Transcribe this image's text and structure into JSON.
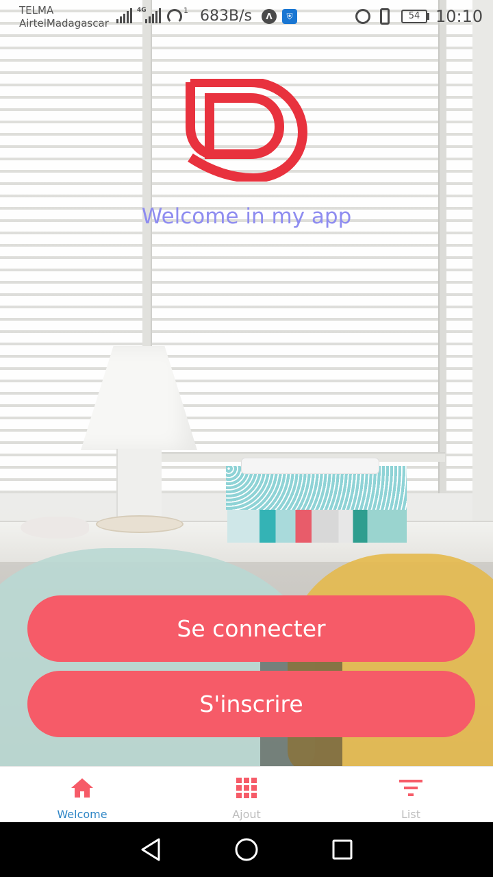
{
  "status_bar": {
    "carrier_line1": "TELMA",
    "carrier_line2": "AirtelMadagascar",
    "network_type": "4G",
    "hotspot_count": "1",
    "speed": "683B/s",
    "battery_level": "54",
    "time": "10:10",
    "icons": [
      "signal-icon",
      "network-4g-icon",
      "hotspot-icon",
      "vpn-icon",
      "shield-icon",
      "alarm-icon",
      "vibrate-icon",
      "battery-icon"
    ]
  },
  "welcome": {
    "title": "Welcome in my app"
  },
  "actions": {
    "login_label": "Se connecter",
    "signup_label": "S'inscrire"
  },
  "tabs": [
    {
      "label": "Welcome",
      "icon": "home-icon",
      "active": true
    },
    {
      "label": "Ajout",
      "icon": "grid-icon",
      "active": false
    },
    {
      "label": "List",
      "icon": "filter-icon",
      "active": false
    }
  ],
  "colors": {
    "accent": "#f65b68",
    "logo": "#e8323e",
    "welcome_text": "#8e8cf0",
    "active_tab": "#2f86c6",
    "inactive_tab": "#bdbdbd"
  }
}
